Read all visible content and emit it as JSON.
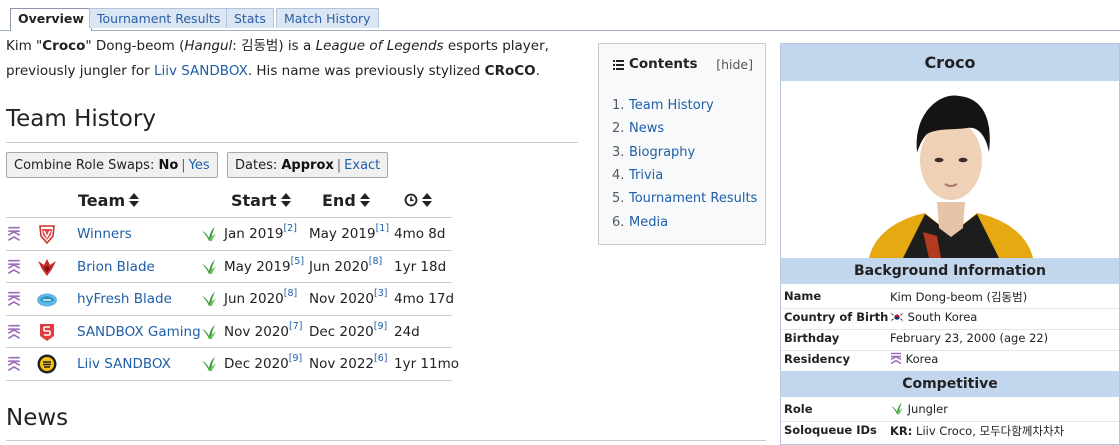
{
  "tabs": {
    "overview": "Overview",
    "tournament_results": "Tournament Results",
    "stats": "Stats",
    "match_history": "Match History"
  },
  "intro": {
    "line1_a": "Kim \"",
    "nick": "Croco",
    "line1_b": "\" Dong-beom (",
    "hangul_label": "Hangul",
    "line1_c": ": 김동범) is a ",
    "game": "League of Legends",
    "line1_d": " esports player,",
    "line2_a": "previously jungler for ",
    "team_link": "Liiv SANDBOX",
    "line2_b": ". His name was previously stylized ",
    "stylized": "CRoCO",
    "line2_c": "."
  },
  "team_history": {
    "heading": "Team History",
    "combine_label": "Combine Role Swaps: ",
    "combine_selected": "No",
    "combine_other": "Yes",
    "dates_label": "Dates: ",
    "dates_selected": "Approx",
    "dates_other": "Exact",
    "columns": {
      "team": "Team",
      "start": "Start",
      "end": "End"
    },
    "rows": [
      {
        "region": "KR",
        "team": "Winners",
        "start": "Jan 2019",
        "start_ref": "[2]",
        "end": "May 2019",
        "end_ref": "[1]",
        "duration": "4mo 8d"
      },
      {
        "region": "KR",
        "team": "Brion Blade",
        "start": "May 2019",
        "start_ref": "[5]",
        "end": "Jun 2020",
        "end_ref": "[8]",
        "duration": "1yr 18d"
      },
      {
        "region": "KR",
        "team": "hyFresh Blade",
        "start": "Jun 2020",
        "start_ref": "[8]",
        "end": "Nov 2020",
        "end_ref": "[3]",
        "duration": "4mo 17d"
      },
      {
        "region": "KR",
        "team": "SANDBOX Gaming",
        "start": "Nov 2020",
        "start_ref": "[7]",
        "end": "Dec 2020",
        "end_ref": "[9]",
        "duration": "24d"
      },
      {
        "region": "KR",
        "team": "Liiv SANDBOX",
        "start": "Dec 2020",
        "start_ref": "[9]",
        "end": "Nov 2022",
        "end_ref": "[6]",
        "duration": "1yr 11mo"
      }
    ]
  },
  "news": {
    "heading": "News"
  },
  "toc": {
    "title": "Contents",
    "hide": "[hide]",
    "items": [
      {
        "num": "1.",
        "label": "Team History"
      },
      {
        "num": "2.",
        "label": "News"
      },
      {
        "num": "3.",
        "label": "Biography"
      },
      {
        "num": "4.",
        "label": "Trivia"
      },
      {
        "num": "5.",
        "label": "Tournament Results"
      },
      {
        "num": "6.",
        "label": "Media"
      }
    ]
  },
  "infobox": {
    "title": "Croco",
    "background_heading": "Background Information",
    "name_label": "Name",
    "name_value": "Kim Dong-beom (김동범)",
    "country_label": "Country of Birth",
    "country_value": "South Korea",
    "birthday_label": "Birthday",
    "birthday_value": "February 23, 2000 (age 22)",
    "residency_label": "Residency",
    "residency_value": "Korea",
    "competitive_heading": "Competitive",
    "role_label": "Role",
    "role_value": "Jungler",
    "soloqueue_label": "Soloqueue IDs",
    "soloqueue_region": "KR:",
    "soloqueue_value": " Liiv Croco, 모두다함께차차차"
  },
  "colors": {
    "link": "#1f5ea8",
    "infobox_header": "#c2d6ee",
    "region_icon": "#9b6bb8",
    "role_icon": "#3f9a3a"
  }
}
